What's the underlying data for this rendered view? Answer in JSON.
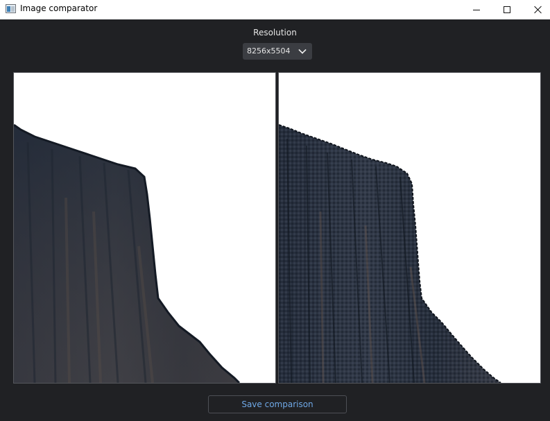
{
  "window": {
    "title": "Image comparator",
    "controls": {
      "minimize": "minimize-icon",
      "maximize": "maximize-icon",
      "close": "close-icon"
    }
  },
  "resolution": {
    "label": "Resolution",
    "selected": "8256x5504",
    "dropdown_icon": "chevron-down-icon"
  },
  "images": {
    "left": {
      "description_icon": "cliff-image"
    },
    "right": {
      "description_icon": "cliff-image"
    }
  },
  "actions": {
    "save_label": "Save comparison"
  },
  "colors": {
    "background": "#202124",
    "panel_border": "#54565b",
    "accent_text": "#6fa8e6",
    "dropdown_bg": "#3b3d42"
  }
}
